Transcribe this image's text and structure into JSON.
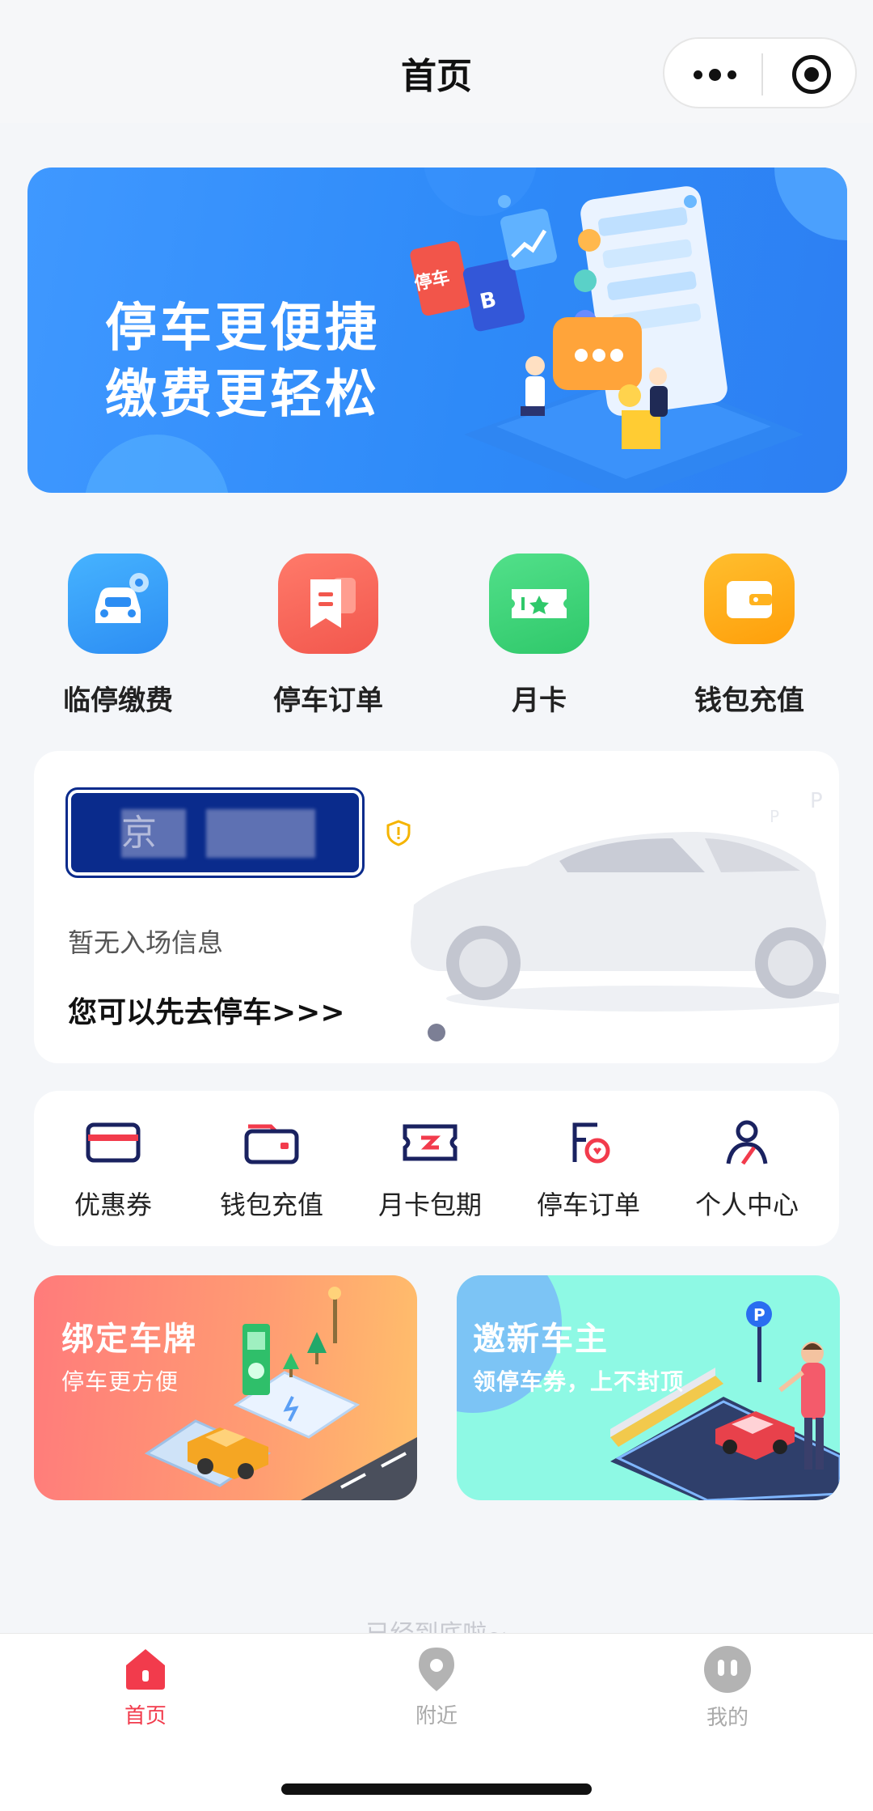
{
  "header": {
    "title": "首页"
  },
  "banner": {
    "line1": "停车更便捷",
    "line2": "缴费更轻松",
    "badge1": "停车",
    "badge2": "B"
  },
  "nav_grid": [
    {
      "label": "临停缴费",
      "icon": "car-icon",
      "color": "#2c8df3"
    },
    {
      "label": "停车订单",
      "icon": "receipt-icon",
      "color": "#f2574d"
    },
    {
      "label": "月卡",
      "icon": "ticket-icon",
      "color": "#2fc86a"
    },
    {
      "label": "钱包充值",
      "icon": "wallet-icon",
      "color": "#ff9f0a"
    }
  ],
  "vehicle": {
    "plate": "京",
    "status": "暂无入场信息",
    "cta": "您可以先去停车>>>"
  },
  "quick_menu": [
    {
      "label": "优惠券",
      "icon": "coupon-icon"
    },
    {
      "label": "钱包充值",
      "icon": "wallet-icon"
    },
    {
      "label": "月卡包期",
      "icon": "ticket-icon"
    },
    {
      "label": "停车订单",
      "icon": "order-icon"
    },
    {
      "label": "个人中心",
      "icon": "user-icon"
    }
  ],
  "promos": [
    {
      "title": "绑定车牌",
      "subtitle": "停车更方便"
    },
    {
      "title": "邀新车主",
      "subtitle": "领停车券，上不封顶"
    }
  ],
  "footer_hint": "已经到底啦~",
  "tabbar": [
    {
      "label": "首页",
      "icon": "home-icon",
      "active": true
    },
    {
      "label": "附近",
      "icon": "location-icon",
      "active": false
    },
    {
      "label": "我的",
      "icon": "profile-icon",
      "active": false
    }
  ],
  "colors": {
    "accent_red": "#f23b4c",
    "blue": "#2c8df3",
    "navy": "#1a2260",
    "inactive": "#aaaaaa"
  }
}
